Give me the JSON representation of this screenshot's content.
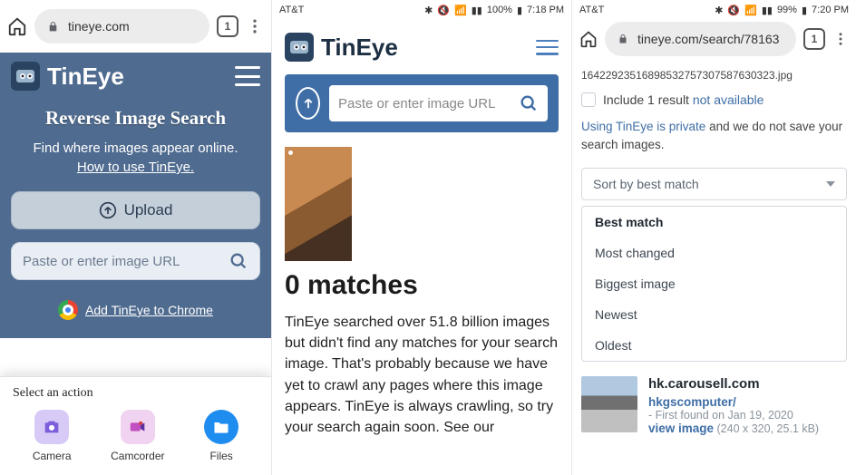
{
  "pane1": {
    "chrome": {
      "host": "tineye.com",
      "tab_count": "1"
    },
    "brand": "TinEye",
    "title": "Reverse Image Search",
    "subtitle": "Find where images appear online.",
    "howto": "How to use TinEye.",
    "upload_label": "Upload",
    "url_placeholder": "Paste or enter image URL",
    "add_chrome": "Add TinEye to Chrome",
    "sheet": {
      "title": "Select an action",
      "actions": [
        {
          "label": "Camera"
        },
        {
          "label": "Camcorder"
        },
        {
          "label": "Files"
        }
      ]
    }
  },
  "pane2": {
    "status": {
      "carrier": "AT&T",
      "battery_pct": "100%",
      "time": "7:18 PM"
    },
    "brand": "TinEye",
    "url_placeholder": "Paste or enter image URL",
    "matches_heading": "0 matches",
    "body": "TinEye searched over 51.8 billion images but didn't find any matches for your search image. That's probably because we have yet to crawl any pages where this image appears. TinEye is always crawling, so try your search again soon. See our"
  },
  "pane3": {
    "status": {
      "carrier": "AT&T",
      "battery_pct": "99%",
      "time": "7:20 PM"
    },
    "chrome": {
      "host": "tineye.com/search/78163",
      "tab_count": "1"
    },
    "crumb": "164229235168985327573075876­30323.jpg",
    "include": {
      "prefix": "Include 1 result ",
      "link": "not available"
    },
    "privacy": {
      "link": "Using TinEye is private",
      "tail": " and we do not save your search images."
    },
    "sort_label": "Sort by best match",
    "options": [
      "Best match",
      "Most changed",
      "Biggest image",
      "Newest",
      "Oldest"
    ],
    "result": {
      "domain": "hk.carousell.com",
      "account": "hkgscomputer/",
      "found": "- First found on Jan 19, 2020",
      "view": "view image",
      "dims": " (240 x 320, 25.1 kB)"
    }
  }
}
